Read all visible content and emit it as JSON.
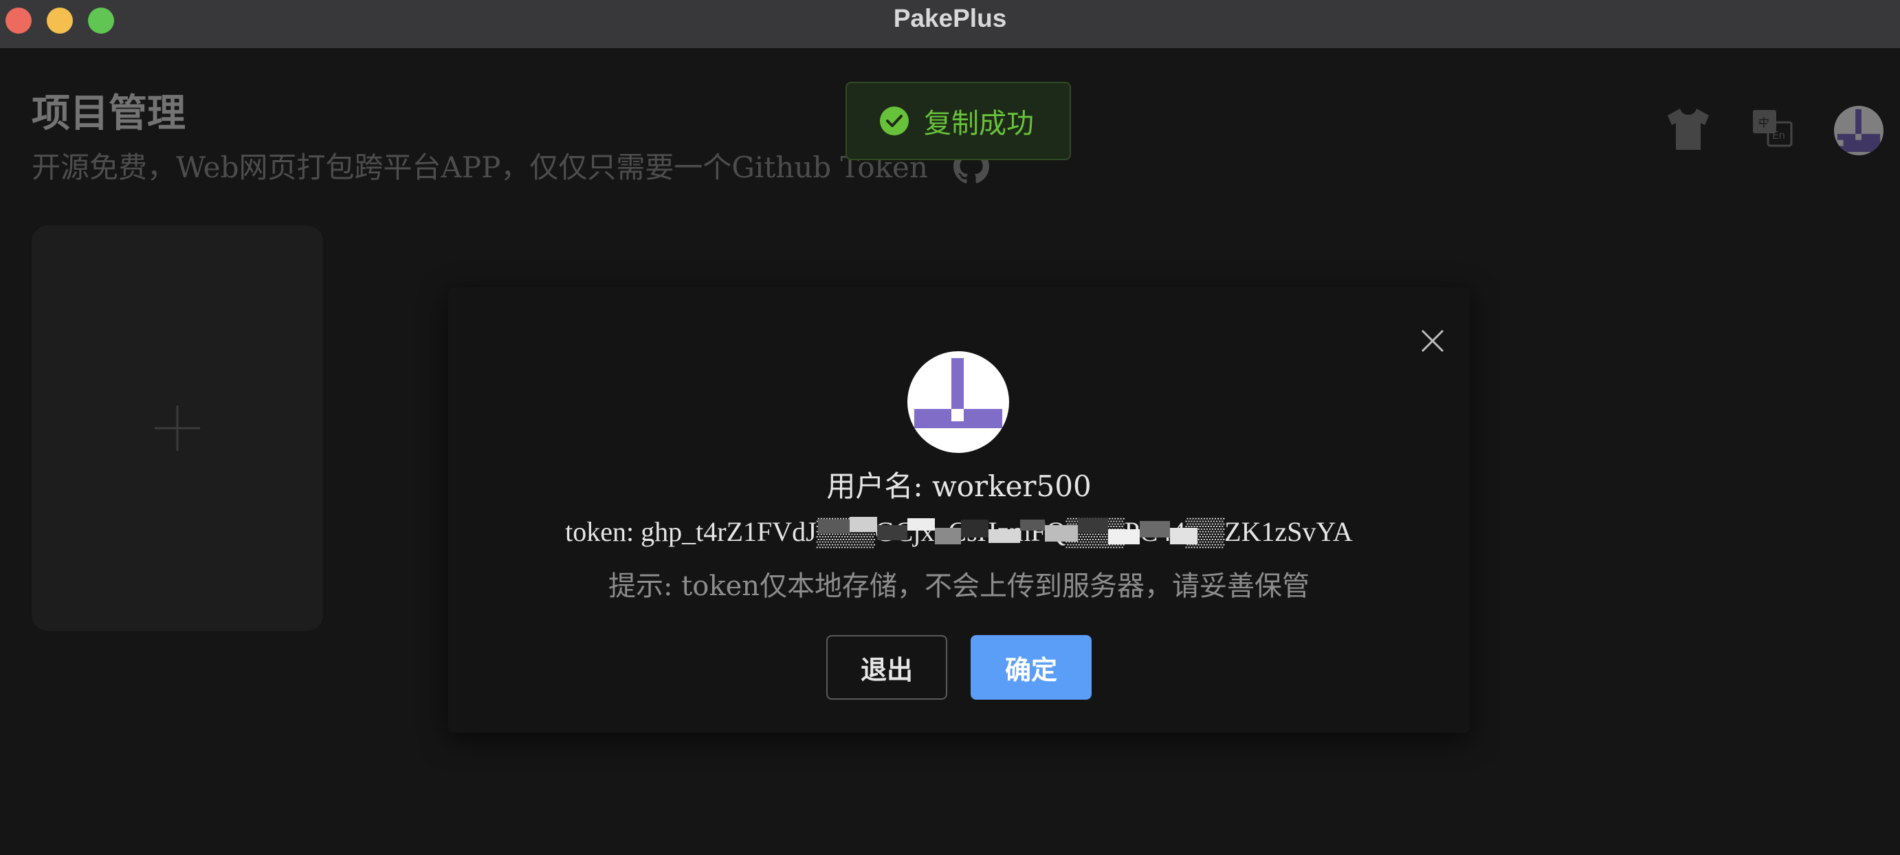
{
  "window": {
    "title": "PakePlus"
  },
  "page": {
    "title": "项目管理",
    "subtitle": "开源免费，Web网页打包跨平台APP，仅仅只需要一个Github Token",
    "add_card_icon": "plus-icon"
  },
  "header_icons": [
    "shirt-icon",
    "translate-icon",
    "avatar"
  ],
  "toast": {
    "message": "复制成功",
    "icon": "check-circle-icon",
    "color": "#67c23a"
  },
  "dialog": {
    "username_line": "用户名: worker500",
    "token_line": "token: ghp_t4rZ1FVdJ▒▒▒GCjxoCsHzmFQ▒▒▒PC44▒▒ZK1zSvYA",
    "hint": "提示: token仅本地存储，不会上传到服务器，请妥善保管",
    "logout_label": "退出",
    "confirm_label": "确定"
  },
  "colors": {
    "accent": "#5b9ef7",
    "avatar_purple": "#7f6dc8",
    "success": "#67c23a"
  }
}
